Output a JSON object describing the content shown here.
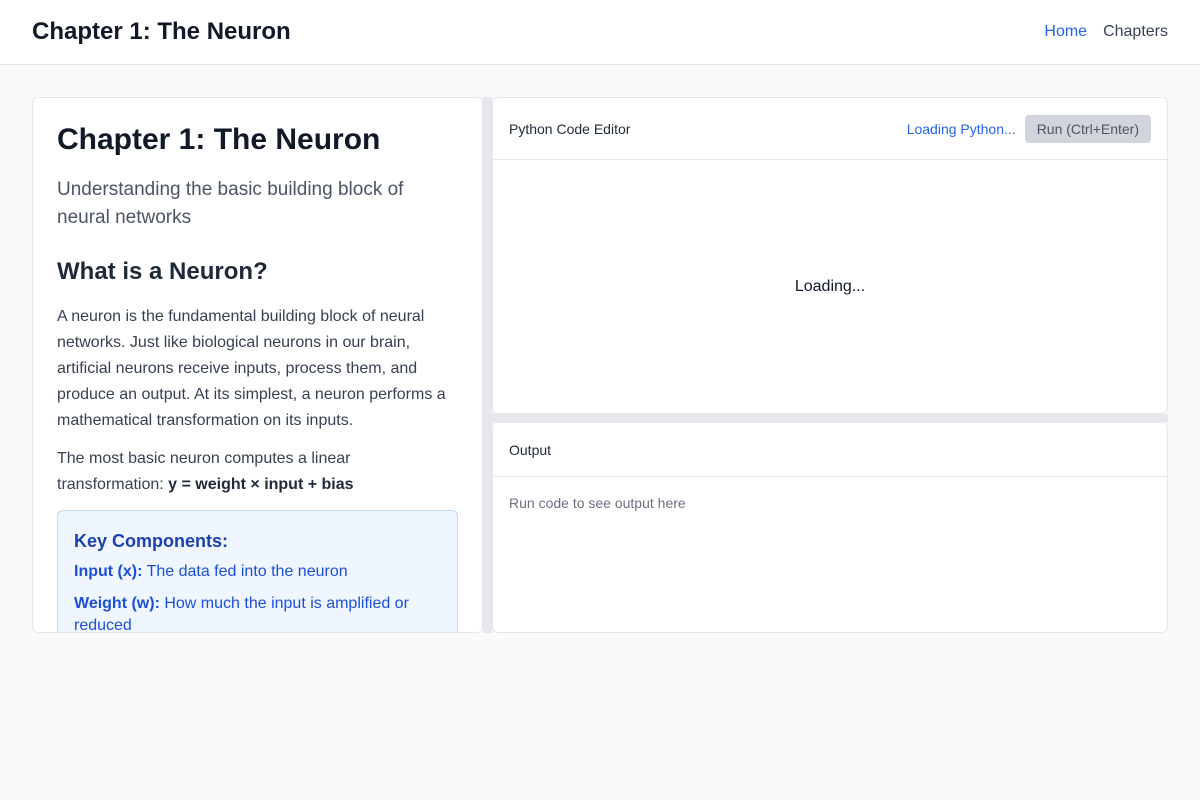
{
  "header": {
    "title": "Chapter 1: The Neuron",
    "nav": [
      {
        "label": "Home"
      },
      {
        "label": "Chapters"
      }
    ]
  },
  "lesson": {
    "title": "Chapter 1: The Neuron",
    "subtitle": "Understanding the basic building block of neural networks",
    "section_heading": "What is a Neuron?",
    "paragraph1": "A neuron is the fundamental building block of neural networks. Just like biological neurons in our brain, artificial neurons receive inputs, process them, and produce an output. At its simplest, a neuron performs a mathematical transformation on its inputs.",
    "paragraph2_prefix": "The most basic neuron computes a linear transformation: ",
    "paragraph2_formula": "y = weight × input + bias",
    "key_components": {
      "heading": "Key Components:",
      "items": [
        {
          "term": "Input (x):",
          "desc": " The data fed into the neuron"
        },
        {
          "term": "Weight (w):",
          "desc": " How much the input is amplified or reduced"
        }
      ]
    }
  },
  "editor": {
    "label": "Python Code Editor",
    "status": "Loading Python...",
    "run_label": "Run (Ctrl+Enter)",
    "body_text": "Loading..."
  },
  "output": {
    "label": "Output",
    "placeholder": "Run code to see output here"
  },
  "colors": {
    "accent": "#2563eb",
    "key_box_bg": "#eff6ff",
    "key_box_text": "#1d4ed8",
    "page_bg": "#f8fafc"
  }
}
